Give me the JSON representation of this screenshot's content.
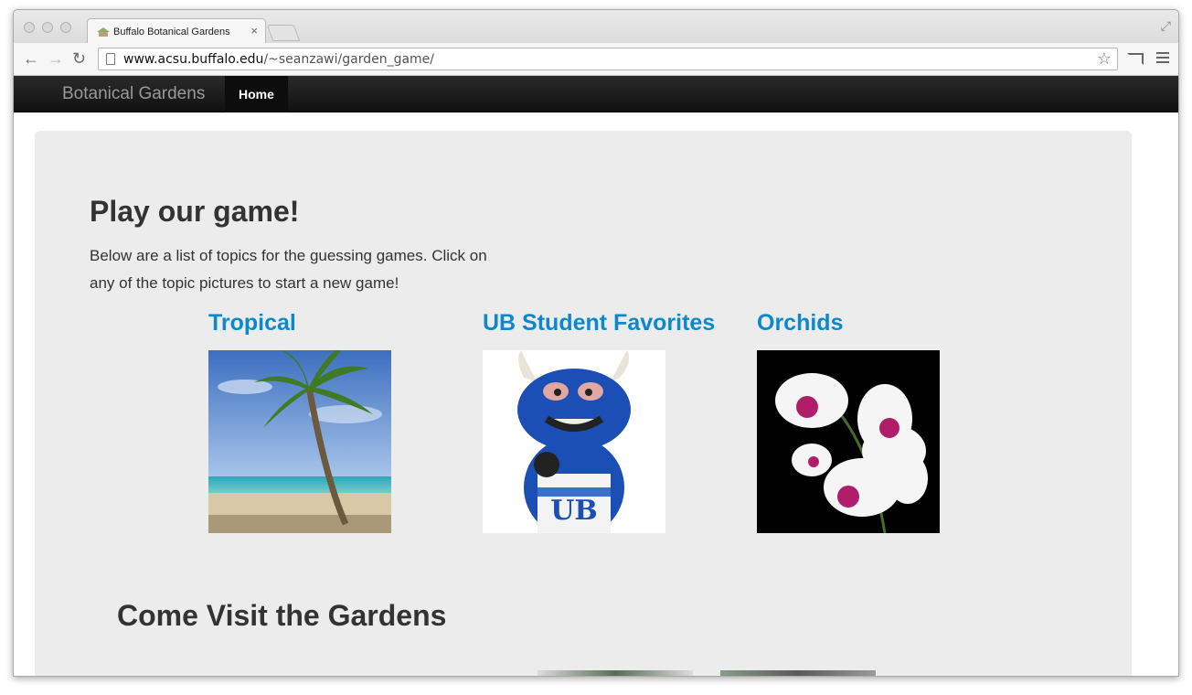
{
  "browser": {
    "tab_title": "Buffalo Botanical Gardens",
    "tab_close": "×",
    "url_host": "www.acsu.buffalo.edu",
    "url_path": "/~seanzawi/garden_game/",
    "back": "←",
    "forward": "→",
    "reload": "↻",
    "star": "☆",
    "fullscreen": "⤢"
  },
  "navbar": {
    "brand": "Botanical Gardens",
    "home": "Home"
  },
  "hero": {
    "title": "Play our game!",
    "text": "Below are a list of topics for the guessing games. Click on any of the topic pictures to start a new game!"
  },
  "topics": [
    {
      "label": "Tropical",
      "image": "palm-tree-beach"
    },
    {
      "label": "UB Student Favorites",
      "image": "ub-bull-mascot"
    },
    {
      "label": "Orchids",
      "image": "white-orchids"
    }
  ],
  "visit": {
    "title": "Come Visit the Gardens"
  },
  "colors": {
    "link": "#0e88cc",
    "hero_bg": "#ececec",
    "navbar_bg": "#1b1b1b"
  }
}
